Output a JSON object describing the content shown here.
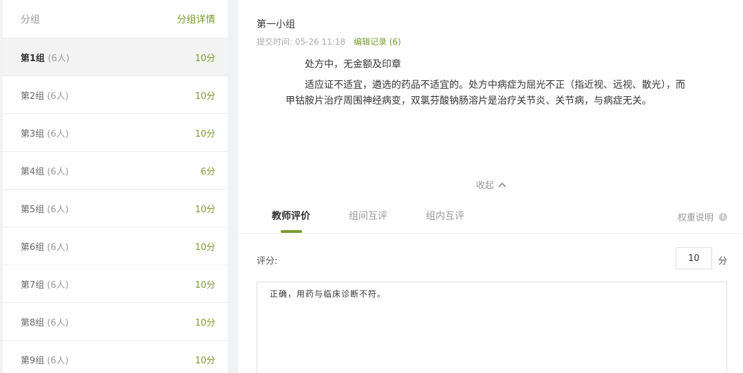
{
  "sidebar": {
    "title": "分组",
    "detail_link": "分组详情",
    "groups": [
      {
        "name": "第1组",
        "count": "(6人)",
        "score": "10分"
      },
      {
        "name": "第2组",
        "count": "(6人)",
        "score": "10分"
      },
      {
        "name": "第3组",
        "count": "(6人)",
        "score": "10分"
      },
      {
        "name": "第4组",
        "count": "(6人)",
        "score": "6分"
      },
      {
        "name": "第5组",
        "count": "(6人)",
        "score": "10分"
      },
      {
        "name": "第6组",
        "count": "(6人)",
        "score": "10分"
      },
      {
        "name": "第7组",
        "count": "(6人)",
        "score": "10分"
      },
      {
        "name": "第8组",
        "count": "(6人)",
        "score": "10分"
      },
      {
        "name": "第9组",
        "count": "(6人)",
        "score": "10分"
      }
    ]
  },
  "main": {
    "subgroup_title": "第一小组",
    "submit_time": "提交时间: 05-26 11:18",
    "edit_record": "编辑记录 (6)",
    "paragraphs": [
      "处方中，无金额及印章",
      "适应证不适宜，遴选的药品不适宜的。处方中病症为屈光不正（指近视、远视、散光），而甲钴胺片治疗周围神经病变，双氯芬酸钠肠溶片是治疗关节炎、关节病，与病症无关。"
    ],
    "collapse_label": "收起",
    "tabs": [
      "教师评价",
      "组间互评",
      "组内互评"
    ],
    "weight_label": "权重说明",
    "score_label": "评分:",
    "score_value": "10",
    "score_unit": "分",
    "comment_text": "正确，用药与临床诊断不符。"
  }
}
